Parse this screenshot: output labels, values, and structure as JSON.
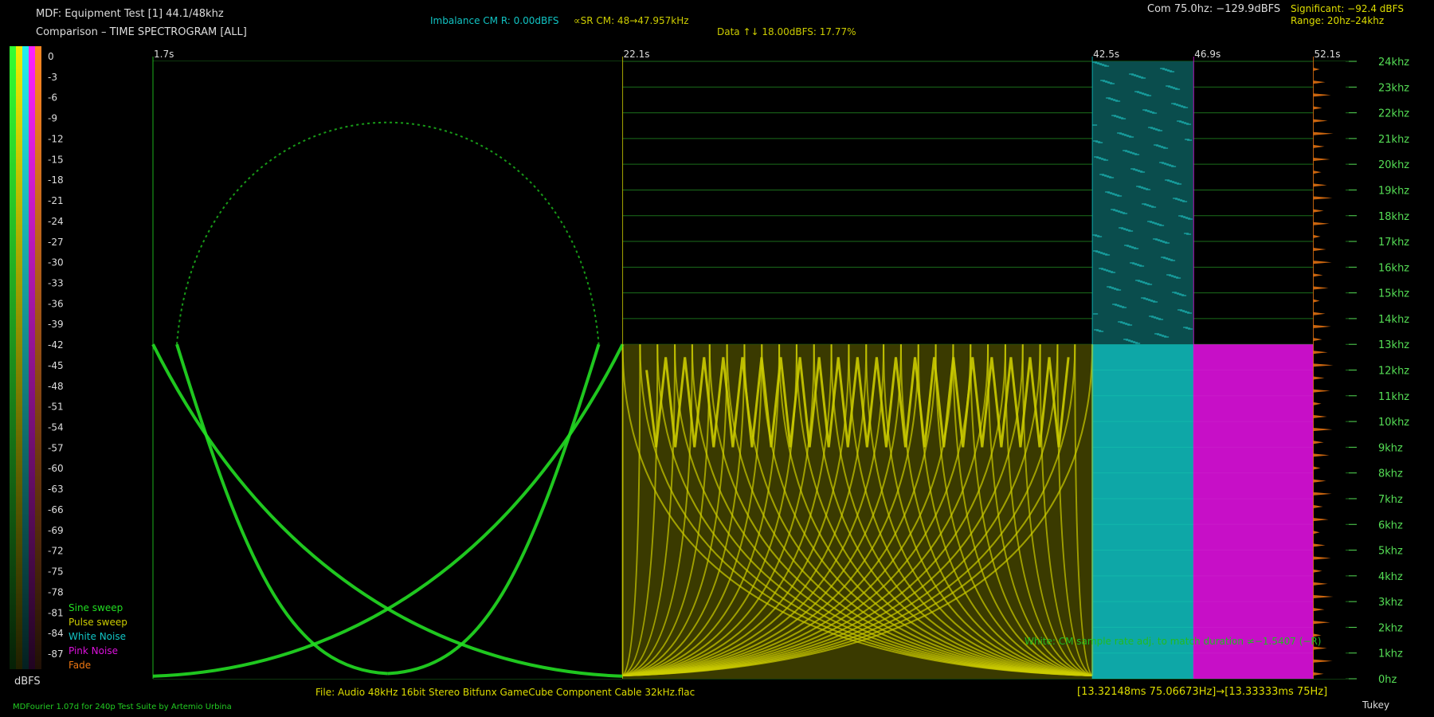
{
  "header": {
    "title": "MDF: Equipment Test [1] 44.1/48khz",
    "subtitle": "Comparison – TIME SPECTROGRAM [ALL]",
    "imbalance": "Imbalance CM R: 0.00dBFS",
    "sr_cm": "∝SR CM: 48→47.957kHz",
    "data_line": "Data ↑↓ 18.00dBFS: 17.77%",
    "com": "Com 75.0hz: −129.9dBFS",
    "significant": "Significant: −92.4 dBFS",
    "range": "Range: 20hz–24khz"
  },
  "colors": {
    "sine": "#22dd22",
    "pulse": "#cccc00",
    "white": "#11c4c4",
    "pink": "#dd11dd",
    "fade": "#ee7711",
    "grid": "#1f7a1f",
    "axis": "#55dd55"
  },
  "legend": [
    {
      "label": "Sine sweep",
      "color": "#22dd22"
    },
    {
      "label": "Pulse sweep",
      "color": "#cccc00"
    },
    {
      "label": "White Noise",
      "color": "#11c4c4"
    },
    {
      "label": "Pink Noise",
      "color": "#dd11dd"
    },
    {
      "label": "Fade",
      "color": "#ee7711"
    }
  ],
  "footer": {
    "file": "File: Audio    48kHz 16bit Stereo Bitfunx GameCube Component Cable 32kHz.flac",
    "bracket": "[13.32148ms 75.06673Hz]→[13.33333ms 75Hz]",
    "window": "Tukey",
    "credit": "MDFourier 1.07d for 240p Test Suite by Artemio Urbina",
    "note": "White: CM sample rate adj. to match duration ≠−1.5407 (−R)"
  },
  "chart_data": {
    "type": "heatmap",
    "title": "Comparison – TIME SPECTROGRAM [ALL]",
    "colorbar": {
      "label": "dBFS",
      "ticks": [
        "0",
        "-3",
        "-6",
        "-9",
        "-12",
        "-15",
        "-18",
        "-21",
        "-24",
        "-27",
        "-30",
        "-33",
        "-36",
        "-39",
        "-42",
        "-45",
        "-48",
        "-51",
        "-54",
        "-57",
        "-60",
        "-63",
        "-66",
        "-69",
        "-72",
        "-75",
        "-78",
        "-81",
        "-84",
        "-87"
      ]
    },
    "x_axis": {
      "unit": "s",
      "markers": [
        {
          "time": "1.7s",
          "color": "#22dd22"
        },
        {
          "time": "22.1s",
          "color": "#cccc00"
        },
        {
          "time": "42.5s",
          "color": "#11c4c4"
        },
        {
          "time": "46.9s",
          "color": "#dd11dd"
        },
        {
          "time": "52.1s",
          "color": "#ee7711"
        }
      ]
    },
    "y_axis": {
      "unit": "khz",
      "ylim": [
        0,
        24
      ],
      "ticks": [
        "0hz",
        "1khz",
        "2khz",
        "3khz",
        "4khz",
        "5khz",
        "6khz",
        "7khz",
        "8khz",
        "9khz",
        "10khz",
        "11khz",
        "12khz",
        "13khz",
        "14khz",
        "15khz",
        "16khz",
        "17khz",
        "18khz",
        "19khz",
        "20khz",
        "21khz",
        "22khz",
        "23khz",
        "24khz"
      ]
    },
    "blocks": [
      {
        "name": "Sine sweep",
        "t_start": 1.7,
        "t_end": 22.1,
        "f_max_khz": 24
      },
      {
        "name": "Pulse sweep",
        "t_start": 22.1,
        "t_end": 42.5,
        "f_max_khz": 13
      },
      {
        "name": "White Noise",
        "t_start": 42.5,
        "t_end": 46.9,
        "f_max_khz": 24
      },
      {
        "name": "Pink Noise",
        "t_start": 46.9,
        "t_end": 52.1,
        "f_max_khz": 13
      },
      {
        "name": "Fade",
        "t_start": 52.1,
        "t_end": 53.5,
        "f_max_khz": 24
      }
    ]
  }
}
